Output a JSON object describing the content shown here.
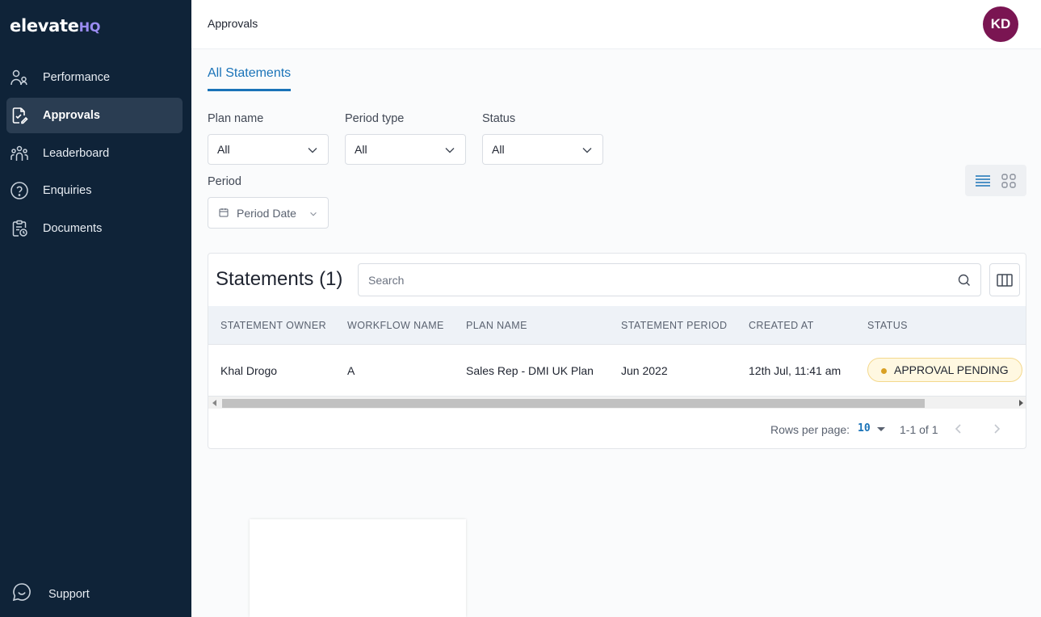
{
  "app": {
    "logo_main": "elevate",
    "logo_suffix": "HQ"
  },
  "sidebar": {
    "items": [
      {
        "label": "Performance",
        "icon": "performance-icon",
        "active": false
      },
      {
        "label": "Approvals",
        "icon": "approvals-icon",
        "active": true
      },
      {
        "label": "Leaderboard",
        "icon": "leaderboard-icon",
        "active": false
      },
      {
        "label": "Enquiries",
        "icon": "help-circle-icon",
        "active": false
      },
      {
        "label": "Documents",
        "icon": "documents-icon",
        "active": false
      }
    ],
    "support_label": "Support"
  },
  "header": {
    "title": "Approvals",
    "avatar_initials": "KD",
    "avatar_color": "#7a1552"
  },
  "tabs": [
    {
      "label": "All Statements",
      "active": true
    }
  ],
  "filters": {
    "plan_name": {
      "label": "Plan name",
      "value": "All"
    },
    "period_type": {
      "label": "Period type",
      "value": "All"
    },
    "status": {
      "label": "Status",
      "value": "All"
    },
    "period": {
      "label": "Period",
      "placeholder": "Period Date"
    }
  },
  "view_toggle": {
    "active": "list"
  },
  "statements": {
    "title": "Statements (1)",
    "search_placeholder": "Search",
    "columns": [
      "STATEMENT OWNER",
      "WORKFLOW NAME",
      "PLAN NAME",
      "STATEMENT PERIOD",
      "CREATED AT",
      "STATUS"
    ],
    "rows": [
      {
        "owner": "Khal Drogo",
        "workflow": "A",
        "plan": "Sales Rep - DMI UK Plan",
        "period": "Jun 2022",
        "created_at": "12th Jul, 11:41 am",
        "status": "APPROVAL PENDING"
      }
    ]
  },
  "pagination": {
    "rows_per_page_label": "Rows per page:",
    "rows_per_page": "10",
    "range": "1-1 of 1"
  },
  "colors": {
    "accent": "#1a73b8",
    "sidebar_bg": "#0f2338",
    "pending_dot": "#d9a024"
  }
}
